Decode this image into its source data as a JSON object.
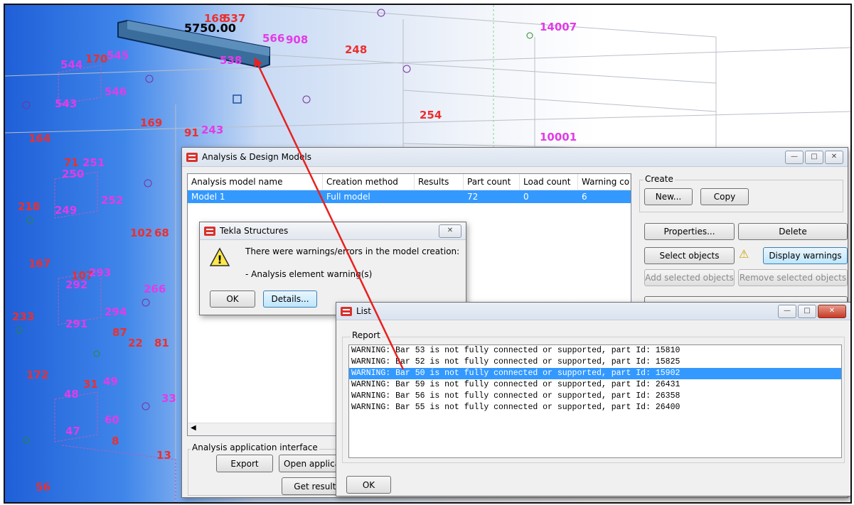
{
  "colors": {
    "selection": "#3399ff",
    "label_magenta": "#e33be8",
    "label_red": "#ec2f2f",
    "arrow": "#e8211f"
  },
  "model_view": {
    "dimension_label": "5750.00",
    "labels": {
      "l168": "168",
      "l537": "537",
      "l908": "908",
      "l566": "566",
      "l248": "248",
      "l14007": "14007",
      "l545": "545",
      "l170": "170",
      "l544": "544",
      "l538": "538",
      "l546": "546",
      "l543": "543",
      "l254": "254",
      "l169": "169",
      "l91": "91",
      "l243": "243",
      "l10001": "10001",
      "l164": "164",
      "l71": "71",
      "l251": "251",
      "l250": "250",
      "l252": "252",
      "l218": "218",
      "l249": "249",
      "l102": "102",
      "l68": "68",
      "l167": "167",
      "l107": "107",
      "l293": "293",
      "l292": "292",
      "l266": "266",
      "l233": "233",
      "l294": "294",
      "l291": "291",
      "l87": "87",
      "l22": "22",
      "l81": "81",
      "l172": "172",
      "l31": "31",
      "l49": "49",
      "l48": "48",
      "l33": "33",
      "l60": "60",
      "l8": "8",
      "l47": "47",
      "l13": "13",
      "l56": "56"
    }
  },
  "analysis_window": {
    "title": "Analysis & Design Models",
    "columns": [
      "Analysis model name",
      "Creation method",
      "Results",
      "Part count",
      "Load count",
      "Warning count"
    ],
    "rows": [
      {
        "name": "Model 1",
        "method": "Full model",
        "results": "",
        "parts": "72",
        "loads": "0",
        "warnings": "6"
      }
    ],
    "create_group": "Create",
    "new_label": "New...",
    "copy_label": "Copy",
    "properties_label": "Properties...",
    "delete_label": "Delete",
    "select_objects_label": "Select objects",
    "display_warnings_label": "Display warnings",
    "add_selected_label": "Add selected objects",
    "remove_selected_label": "Remove selected objects",
    "interface_group": "Analysis application interface",
    "export_label": "Export",
    "open_app_label": "Open application",
    "get_results_label": "Get results"
  },
  "tekla_dialog": {
    "title": "Tekla Structures",
    "message": "There were warnings/errors in the model creation:",
    "detail": "- Analysis element warning(s)",
    "ok_label": "OK",
    "details_label": "Details..."
  },
  "list_window": {
    "title": "List",
    "group": "Report",
    "lines": [
      "WARNING: Bar 53 is not fully connected or supported, part Id: 15810",
      "WARNING: Bar 52 is not fully connected or supported, part Id: 15825",
      "WARNING: Bar 50 is not fully connected or supported, part Id: 15902",
      "WARNING: Bar 59 is not fully connected or supported, part Id: 26431",
      "WARNING: Bar 56 is not fully connected or supported, part Id: 26358",
      "WARNING: Bar 55 is not fully connected or supported, part Id: 26400"
    ],
    "selected_index": 2,
    "ok_label": "OK"
  }
}
